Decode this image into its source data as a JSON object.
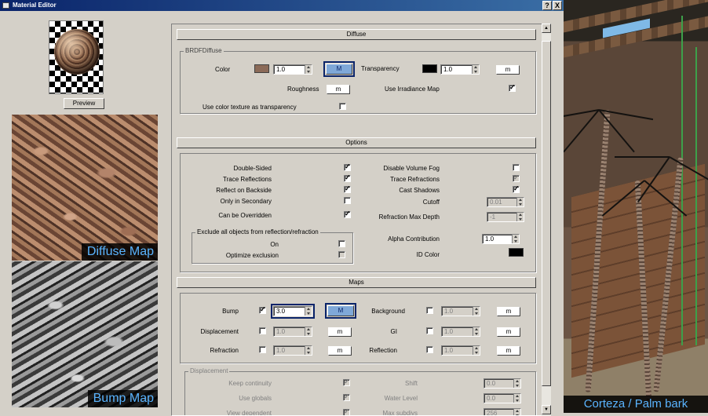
{
  "window": {
    "title": "Material Editor",
    "help_label": "?",
    "close_label": "X"
  },
  "left": {
    "preview_button": "Preview",
    "diffuse_label": "Diffuse Map",
    "bump_label": "Bump Map"
  },
  "diffuse": {
    "header": "Diffuse",
    "group_label": "BRDFDiffuse",
    "color_label": "Color",
    "color_swatch": "#8b6a58",
    "color_value": "1.0",
    "color_map_button": "M",
    "transparency_label": "Transparency",
    "transparency_swatch": "#000000",
    "transparency_value": "1.0",
    "transparency_map_button": "m",
    "roughness_label": "Roughness",
    "roughness_map_button": "m",
    "irradiance_label": "Use Irradiance Map",
    "use_irradiance_map": true,
    "color_tex_transp_label": "Use color texture as transparency",
    "use_color_texture_as_transparency": false
  },
  "options": {
    "header": "Options",
    "double_sided": {
      "label": "Double-Sided",
      "checked": true
    },
    "trace_reflections": {
      "label": "Trace Reflections",
      "checked": true
    },
    "reflect_on_backside": {
      "label": "Reflect on Backside",
      "checked": true
    },
    "only_in_secondary": {
      "label": "Only in Secondary",
      "checked": false
    },
    "can_be_overridden": {
      "label": "Can be Overridden",
      "checked": true
    },
    "disable_volume_fog": {
      "label": "Disable Volume Fog",
      "checked": false
    },
    "trace_refractions": {
      "label": "Trace Refractions",
      "checked": true
    },
    "cast_shadows": {
      "label": "Cast Shadows",
      "checked": true
    },
    "cutoff": {
      "label": "Cutoff",
      "value": "0.01"
    },
    "refraction_max_depth": {
      "label": "Refraction Max Depth",
      "value": "-1"
    },
    "exclude_group_label": "Exclude all objects from reflection/refraction",
    "exclude_on": {
      "label": "On",
      "checked": false
    },
    "optimize_exclusion": {
      "label": "Optimize exclusion",
      "checked": false
    },
    "alpha_contribution": {
      "label": "Alpha Contribution",
      "value": "1.0"
    },
    "id_color": {
      "label": "ID Color",
      "swatch": "#000000"
    }
  },
  "maps": {
    "header": "Maps",
    "bump": {
      "label": "Bump",
      "checked": true,
      "value": "3.0",
      "button": "M"
    },
    "displacement": {
      "label": "Displacement",
      "checked": false,
      "value": "1.0",
      "button": "m"
    },
    "refraction": {
      "label": "Refraction",
      "checked": false,
      "value": "1.0",
      "button": "m"
    },
    "background": {
      "label": "Background",
      "checked": false,
      "value": "1.0",
      "button": "m"
    },
    "gi": {
      "label": "GI",
      "checked": false,
      "value": "1.0",
      "button": "m"
    },
    "reflection": {
      "label": "Reflection",
      "checked": false,
      "value": "1.0",
      "button": "m"
    },
    "displacement_group": {
      "label": "Displacement",
      "keep_continuity": {
        "label": "Keep continuity",
        "checked": true
      },
      "use_globals": {
        "label": "Use globals",
        "checked": true
      },
      "view_dependent": {
        "label": "View dependent",
        "checked": true
      },
      "shift": {
        "label": "Shift",
        "value": "0.0"
      },
      "water_level": {
        "label": "Water Level",
        "value": "0.0"
      },
      "max_subdivs": {
        "label": "Max subdivs",
        "value": "256"
      }
    }
  },
  "scene": {
    "caption": "Corteza / Palm bark"
  }
}
